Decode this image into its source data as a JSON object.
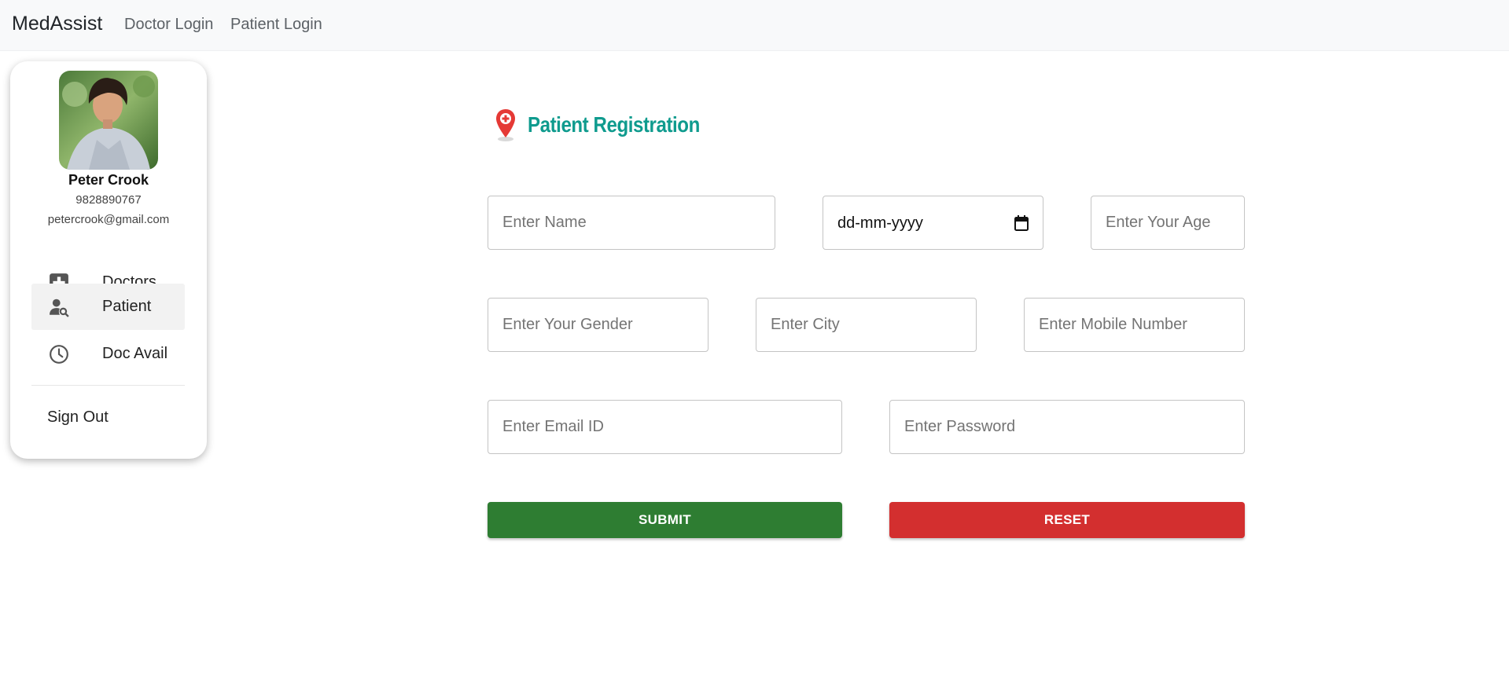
{
  "navbar": {
    "brand": "MedAssist",
    "links": [
      "Doctor Login",
      "Patient Login"
    ]
  },
  "sidebar": {
    "user": {
      "name": "Peter Crook",
      "phone": "9828890767",
      "email": "petercrook@gmail.com"
    },
    "menu": [
      {
        "label": "Doctors",
        "icon": "medical-plus-icon"
      },
      {
        "label": "Patient",
        "icon": "person-search-icon",
        "active": true
      },
      {
        "label": "Doc Avail",
        "icon": "clock-icon"
      }
    ],
    "sign_out": "Sign Out"
  },
  "form": {
    "title": "Patient Registration",
    "title_icon": "map-pin-plus-icon",
    "fields": {
      "name": {
        "placeholder": "Enter Name"
      },
      "dob": {
        "placeholder": "dd-mm-yyyy"
      },
      "age": {
        "placeholder": "Enter Your Age"
      },
      "gender": {
        "placeholder": "Enter Your Gender"
      },
      "city": {
        "placeholder": "Enter City"
      },
      "mobile": {
        "placeholder": "Enter Mobile Number"
      },
      "email": {
        "placeholder": "Enter Email ID"
      },
      "password": {
        "placeholder": "Enter Password"
      }
    },
    "submit_label": "SUBMIT",
    "reset_label": "RESET"
  },
  "colors": {
    "title": "#0f9b8e",
    "submit": "#2e7d32",
    "reset": "#d32f2f",
    "navbar_bg": "#f8f9fa"
  }
}
